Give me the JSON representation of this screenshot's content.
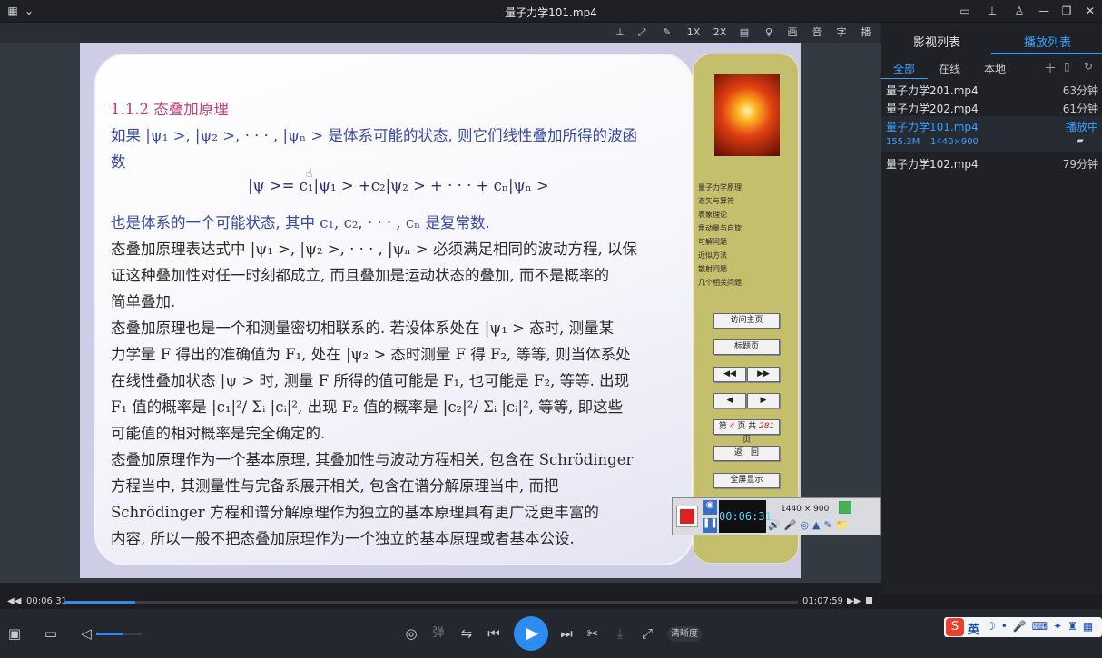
{
  "window": {
    "title": "量子力学101.mp4"
  },
  "video_toolbar": {
    "speed1": "1X",
    "speed2": "2X",
    "paint": "画",
    "audio": "音",
    "subtitle": "字",
    "play_mode": "播"
  },
  "slide": {
    "heading": "1.1.2 态叠加原理",
    "lines": [
      "如果 |ψ₁ >, |ψ₂ >, · · · , |ψₙ > 是体系可能的状态, 则它们线性叠加所得的波函",
      "数",
      "|ψ >= c₁|ψ₁ > +c₂|ψ₂ > + · · · + cₙ|ψₙ >",
      "也是体系的一个可能状态, 其中 c₁, c₂, · · · , cₙ 是复常数.",
      "态叠加原理表达式中 |ψ₁ >, |ψ₂ >, · · · , |ψₙ > 必须满足相同的波动方程, 以保",
      "证这种叠加性对任一时刻都成立, 而且叠加是运动状态的叠加, 而不是概率的",
      "简单叠加.",
      "态叠加原理也是一个和测量密切相联系的. 若设体系处在 |ψ₁ > 态时, 测量某",
      "力学量 F 得出的准确值为 F₁, 处在 |ψ₂ > 态时测量 F 得 F₂, 等等, 则当体系处",
      "在线性叠加状态 |ψ > 时, 测量 F 所得的值可能是 F₁, 也可能是 F₂, 等等. 出现",
      "F₁ 值的概率是 |c₁|²/ Σᵢ |cᵢ|², 出现 F₂ 值的概率是 |c₂|²/ Σᵢ |cᵢ|², 等等, 即这些",
      "可能值的相对概率是完全确定的.",
      "态叠加原理作为一个基本原理, 其叠加性与波动方程相关, 包含在 Schrödinger",
      "方程当中, 其测量性与完备系展开相关, 包含在谱分解原理当中, 而把",
      "Schrödinger 方程和谱分解原理作为独立的基本原理具有更广泛更丰富的",
      "内容, 所以一般不把态叠加原理作为一个独立的基本原理或者基本公设."
    ],
    "nav_items": [
      "量子力学原理",
      "态矢与算符",
      "表象理论",
      "角动量与自旋",
      "可解问题",
      "近似方法",
      "散射问题",
      "几个相关问题"
    ],
    "nav_buttons": {
      "home": "访问主页",
      "title_page": "标题页",
      "fast_back": "◀◀",
      "fast_fwd": "▶▶",
      "prev": "◀",
      "next": "▶",
      "page_prefix": "第",
      "page_num": "4",
      "page_mid": "页 共",
      "page_total": "281",
      "page_suffix": "页",
      "back": "返　回",
      "fullscreen": "全屏显示"
    }
  },
  "recorder": {
    "timer": "00:06:31",
    "resolution": "1440 × 900"
  },
  "panel": {
    "tabs": [
      "影视列表",
      "播放列表"
    ],
    "subtabs": [
      "全部",
      "在线",
      "本地"
    ],
    "items": [
      {
        "name": "量子力学201.mp4",
        "meta": "63分钟"
      },
      {
        "name": "量子力学202.mp4",
        "meta": "61分钟"
      },
      {
        "name": "量子力学101.mp4",
        "meta": "播放中",
        "size": "155.3M",
        "res": "1440×900"
      },
      {
        "name": "量子力学102.mp4",
        "meta": "79分钟"
      }
    ]
  },
  "player": {
    "elapsed": "00:06:31",
    "duration": "01:07:59",
    "progress": 0.096,
    "volume": 0.6,
    "danmaku": "弹",
    "quality": "清晰度"
  },
  "ime": {
    "lang": "英"
  },
  "colors": {
    "accent": "#2d8cf0",
    "playlist_active": "#3aa0ff"
  }
}
